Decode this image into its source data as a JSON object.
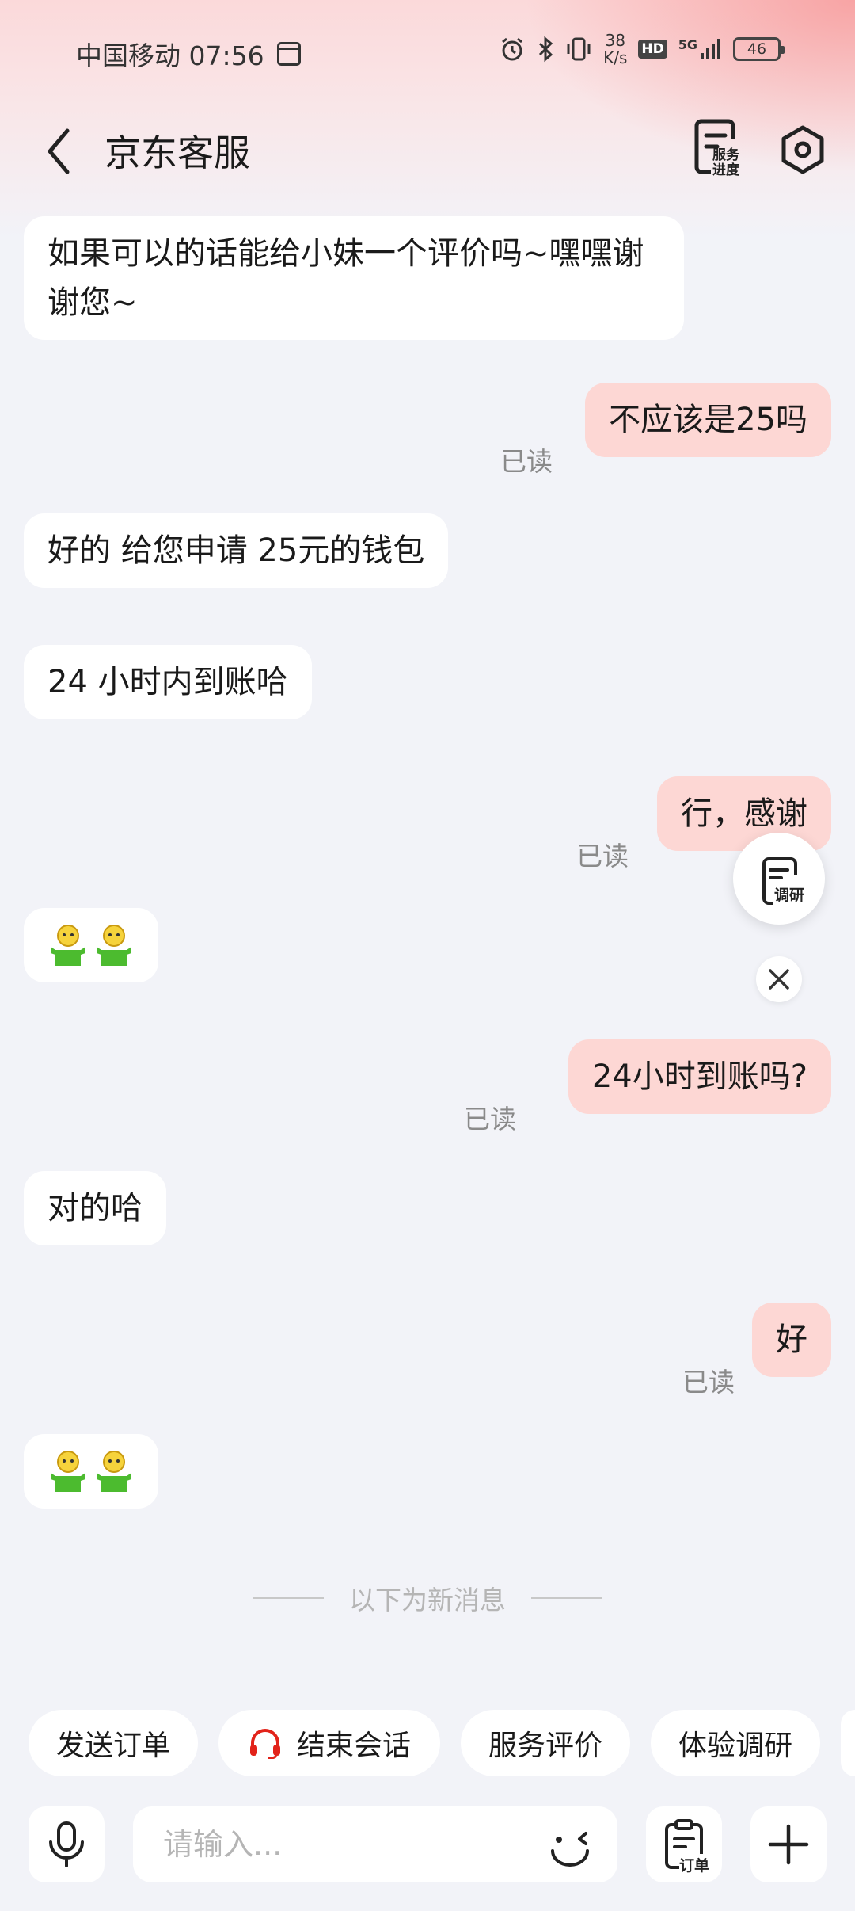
{
  "status_bar": {
    "carrier_time": "中国移动 07:56",
    "net_speed_value": "38",
    "net_speed_unit": "K/s",
    "hd_label": "HD",
    "signal_label": "5G",
    "battery": "46"
  },
  "header": {
    "title": "京东客服",
    "service_progress_label_line1": "服务",
    "service_progress_label_line2": "进度"
  },
  "messages": [
    {
      "side": "in",
      "text": "如果可以的话能给小妹一个评价吗~嘿嘿谢谢您~"
    },
    {
      "side": "out",
      "text": "不应该是25吗",
      "read": "已读"
    },
    {
      "side": "in",
      "text": "好的 给您申请 25元的钱包"
    },
    {
      "side": "in",
      "text": "24 小时内到账哈"
    },
    {
      "side": "out",
      "text": "行，感谢",
      "read": "已读"
    },
    {
      "side": "in",
      "type": "emoji"
    },
    {
      "side": "out",
      "text": "24小时到账吗?",
      "read": "已读"
    },
    {
      "side": "in",
      "text": "对的哈"
    },
    {
      "side": "out",
      "text": "好",
      "read": "已读"
    },
    {
      "side": "in",
      "type": "emoji"
    }
  ],
  "divider_text": "以下为新消息",
  "survey_fab_label": "调研",
  "quick_actions": [
    {
      "label": "发送订单"
    },
    {
      "label": "结束会话",
      "icon": "headset-icon"
    },
    {
      "label": "服务评价"
    },
    {
      "label": "体验调研"
    }
  ],
  "input": {
    "placeholder": "请输入...",
    "order_label": "订单"
  },
  "colors": {
    "bubble_out": "#fdd7d4",
    "bubble_in": "#ffffff",
    "background": "#f2f3f8",
    "headset_red": "#e2231a"
  }
}
